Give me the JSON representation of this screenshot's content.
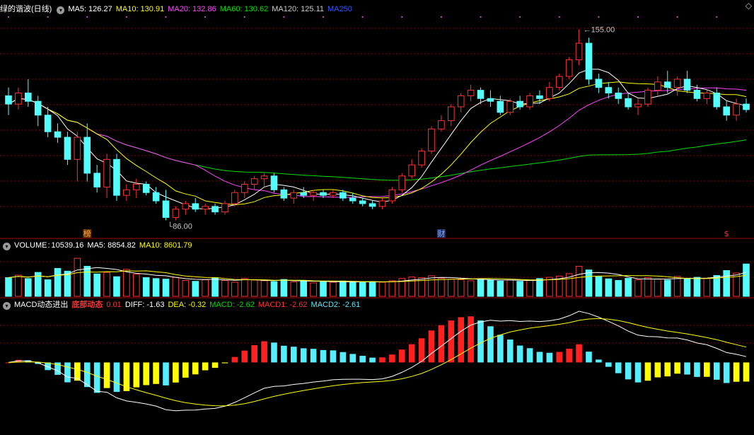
{
  "panel_titles": {
    "main": "绿的谐波(日线)",
    "volume": "VOLUME",
    "macd": "MACD动态进出"
  },
  "main_indicators": [
    {
      "label": "MA5: 126.27",
      "color": "#ffffff"
    },
    {
      "label": "MA10: 130.91",
      "color": "#ffff00"
    },
    {
      "label": "MA20: 132.86",
      "color": "#ff44ff"
    },
    {
      "label": "MA60: 130.62",
      "color": "#00dd00"
    },
    {
      "label": "MA120: 125.11",
      "color": "#cccccc"
    },
    {
      "label": "MA250",
      "color": "#3355ff"
    }
  ],
  "volume_indicators": [
    {
      "label": "10539.16",
      "color": "#ffffff"
    },
    {
      "label": "MA5: 8854.82",
      "color": "#ffffff"
    },
    {
      "label": "MA10: 8601.79",
      "color": "#ffff00"
    }
  ],
  "macd_indicators": [
    {
      "label": "底部动态",
      "color": "#ff3333",
      "bold": true
    },
    {
      "label": "0.01",
      "color": "#ff3333"
    },
    {
      "label": "DIFF: -1.63",
      "color": "#ffffff"
    },
    {
      "label": "DEA: -0.32",
      "color": "#ffff00"
    },
    {
      "label": "MACD: -2.62",
      "color": "#00dd00"
    },
    {
      "label": "MACD1: -2.62",
      "color": "#ff3333"
    },
    {
      "label": "MACD2: -2.61",
      "color": "#55eeff"
    }
  ],
  "markers": {
    "high_label": "155.00",
    "low_label": "86.00",
    "event_1": "榜",
    "event_2": "财",
    "event_3": "$"
  },
  "close_icon": "close-x-icon",
  "colors": {
    "up": "#ff3232",
    "down": "#54fcfc",
    "grid": "#8a0000",
    "macd_pos_up": "#ff2020",
    "macd_pos_down": "#55eeff",
    "macd_neg_down": "#55eeff",
    "macd_neg_up": "#ffff00"
  },
  "chart_data": {
    "type": "candlestick",
    "title": "绿的谐波(日线)",
    "y_high_marked": 155.0,
    "y_low_marked": 86.0,
    "candles": [
      [
        131,
        134,
        124,
        128
      ],
      [
        128,
        134,
        126,
        132
      ],
      [
        132,
        137,
        127,
        129
      ],
      [
        129,
        131,
        120,
        124
      ],
      [
        124,
        127,
        116,
        118
      ],
      [
        118,
        121,
        114,
        116
      ],
      [
        116,
        118,
        106,
        108
      ],
      [
        108,
        118,
        100,
        116
      ],
      [
        116,
        121,
        100,
        103
      ],
      [
        103,
        106,
        96,
        98
      ],
      [
        98,
        110,
        94,
        108
      ],
      [
        108,
        110,
        93,
        95
      ],
      [
        95,
        99,
        93,
        97
      ],
      [
        97,
        101,
        94,
        99
      ],
      [
        99,
        100,
        95,
        96
      ],
      [
        96,
        98,
        92,
        93
      ],
      [
        93,
        97,
        86,
        87
      ],
      [
        87,
        91,
        86,
        90
      ],
      [
        90,
        93,
        88,
        92
      ],
      [
        92,
        94,
        89,
        90
      ],
      [
        90,
        92,
        88,
        91
      ],
      [
        91,
        92,
        88,
        89
      ],
      [
        89,
        93,
        88,
        92
      ],
      [
        92,
        97,
        91,
        96
      ],
      [
        96,
        100,
        94,
        99
      ],
      [
        99,
        102,
        97,
        101
      ],
      [
        101,
        103,
        98,
        102
      ],
      [
        102,
        103,
        96,
        97
      ],
      [
        97,
        98,
        93,
        94
      ],
      [
        94,
        97,
        92,
        96
      ],
      [
        96,
        98,
        94,
        95
      ],
      [
        95,
        97,
        93,
        96
      ],
      [
        96,
        97,
        94,
        95
      ],
      [
        95,
        97,
        94,
        96
      ],
      [
        96,
        97,
        93,
        94
      ],
      [
        94,
        96,
        92,
        93
      ],
      [
        93,
        94,
        91,
        92
      ],
      [
        92,
        93,
        90,
        91
      ],
      [
        91,
        94,
        90,
        93
      ],
      [
        93,
        98,
        92,
        97
      ],
      [
        97,
        103,
        96,
        102
      ],
      [
        102,
        108,
        101,
        106
      ],
      [
        106,
        112,
        105,
        111
      ],
      [
        111,
        120,
        110,
        119
      ],
      [
        119,
        124,
        118,
        122
      ],
      [
        122,
        128,
        120,
        127
      ],
      [
        127,
        132,
        125,
        131
      ],
      [
        131,
        135,
        129,
        133
      ],
      [
        133,
        134,
        128,
        130
      ],
      [
        130,
        133,
        127,
        129
      ],
      [
        129,
        131,
        124,
        125
      ],
      [
        125,
        130,
        124,
        129
      ],
      [
        129,
        131,
        126,
        127
      ],
      [
        127,
        132,
        126,
        131
      ],
      [
        131,
        133,
        128,
        130
      ],
      [
        130,
        136,
        129,
        134
      ],
      [
        134,
        139,
        133,
        138
      ],
      [
        138,
        145,
        137,
        144
      ],
      [
        144,
        155,
        142,
        150
      ],
      [
        150,
        152,
        135,
        137
      ],
      [
        137,
        139,
        132,
        134
      ],
      [
        134,
        136,
        130,
        132
      ],
      [
        132,
        134,
        128,
        130
      ],
      [
        130,
        132,
        126,
        127
      ],
      [
        127,
        130,
        124,
        128
      ],
      [
        128,
        134,
        127,
        133
      ],
      [
        133,
        138,
        131,
        136
      ],
      [
        136,
        140,
        132,
        134
      ],
      [
        134,
        138,
        131,
        137
      ],
      [
        137,
        140,
        132,
        133
      ],
      [
        133,
        135,
        129,
        130
      ],
      [
        130,
        133,
        128,
        132
      ],
      [
        132,
        134,
        126,
        127
      ],
      [
        127,
        129,
        122,
        124
      ],
      [
        124,
        130,
        122,
        128
      ],
      [
        128,
        130,
        125,
        126
      ]
    ],
    "main_panel_range": [
      82,
      160
    ],
    "volume": [
      6100,
      6900,
      5800,
      7800,
      5400,
      9100,
      8200,
      12400,
      9800,
      7300,
      7800,
      6400,
      8800,
      7200,
      6100,
      5800,
      5600,
      6200,
      5200,
      4900,
      5400,
      6100,
      5200,
      4600,
      5800,
      5300,
      5100,
      4800,
      5500,
      4700,
      5200,
      4400,
      4800,
      4600,
      5000,
      4700,
      4500,
      4800,
      4600,
      5100,
      5800,
      6300,
      6100,
      6700,
      5900,
      5600,
      5400,
      5100,
      5700,
      5400,
      5000,
      5300,
      4900,
      5200,
      5800,
      6200,
      6600,
      7400,
      9800,
      8600,
      6400,
      5700,
      5200,
      5900,
      5400,
      6100,
      5600,
      5300,
      6500,
      5900,
      6200,
      5800,
      6800,
      8400,
      7600,
      10539
    ],
    "volume_range": [
      0,
      14500
    ],
    "macd_range": [
      -3.3,
      2.4
    ],
    "labels": {
      "volume_ma5": "8854.82",
      "volume_ma10": "8601.79",
      "diff": "-1.63",
      "dea": "-0.32",
      "macd": "-2.62"
    }
  }
}
